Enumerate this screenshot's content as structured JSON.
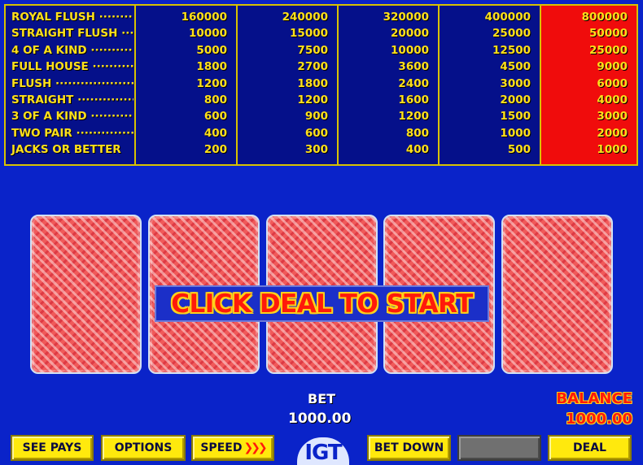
{
  "paytable": {
    "hands": [
      {
        "name": "ROYAL FLUSH",
        "dots": "·········",
        "pays": [
          "160000",
          "240000",
          "320000",
          "400000",
          "800000"
        ]
      },
      {
        "name": "STRAIGHT FLUSH",
        "dots": "···",
        "pays": [
          "10000",
          "15000",
          "20000",
          "25000",
          "50000"
        ]
      },
      {
        "name": "4 OF A KIND",
        "dots": "··········",
        "pays": [
          "5000",
          "7500",
          "10000",
          "12500",
          "25000"
        ]
      },
      {
        "name": "FULL HOUSE",
        "dots": "···········",
        "pays": [
          "1800",
          "2700",
          "3600",
          "4500",
          "9000"
        ]
      },
      {
        "name": "FLUSH",
        "dots": "·····················",
        "pays": [
          "1200",
          "1800",
          "2400",
          "3000",
          "6000"
        ]
      },
      {
        "name": "STRAIGHT",
        "dots": "··············",
        "pays": [
          "800",
          "1200",
          "1600",
          "2000",
          "4000"
        ]
      },
      {
        "name": "3 OF A KIND",
        "dots": "···········",
        "pays": [
          "600",
          "900",
          "1200",
          "1500",
          "3000"
        ]
      },
      {
        "name": "TWO PAIR",
        "dots": "···············",
        "pays": [
          "400",
          "600",
          "800",
          "1000",
          "2000"
        ]
      },
      {
        "name": "JACKS OR BETTER",
        "dots": "",
        "pays": [
          "200",
          "300",
          "400",
          "500",
          "1000"
        ]
      }
    ],
    "highlight_column": 4,
    "colors": {
      "background": "#05108a",
      "highlight": "#f00c0c",
      "text": "#ffe01a",
      "border": "#d9c200"
    }
  },
  "cards": [
    {
      "state": "face-down"
    },
    {
      "state": "face-down"
    },
    {
      "state": "face-down"
    },
    {
      "state": "face-down"
    },
    {
      "state": "face-down"
    }
  ],
  "message": "CLICK DEAL TO START",
  "bet": {
    "label": "BET",
    "value": "1000.00"
  },
  "balance": {
    "label": "BALANCE",
    "value": "1000.00"
  },
  "buttons": {
    "see_pays": "SEE PAYS",
    "options": "OPTIONS",
    "speed": "SPEED",
    "speed_icon": "chevrons-right-icon",
    "bet_down": "BET DOWN",
    "bet_up": "",
    "deal": "DEAL"
  },
  "logo": "IGT",
  "colors": {
    "page": "#0a23c9",
    "button": "#ffe90d",
    "button_disabled": "#707070",
    "banner_text": "#ff1a0a"
  }
}
